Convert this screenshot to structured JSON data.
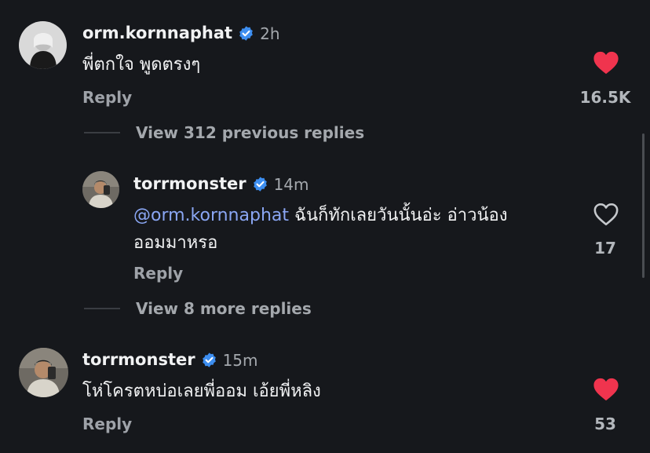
{
  "comments": [
    {
      "username": "orm.kornnaphat",
      "time": "2h",
      "text": "พี่ตกใจ พูดตรงๆ",
      "reply_label": "Reply",
      "likes": "16.5K",
      "liked": true
    },
    {
      "username": "torrmonster",
      "time": "14m",
      "mention": "@orm.kornnaphat",
      "text_line1": " ฉันก็ทักเลยวันนั้นอ่ะ  อ่าวน้อง",
      "text_line2": "ออมมาหรอ",
      "reply_label": "Reply",
      "likes": "17",
      "liked": false
    },
    {
      "username": "torrmonster",
      "time": "15m",
      "text": "โห่โครตหบ่อเลยพี่ออม เอ้ยพี่หลิง",
      "reply_label": "Reply",
      "likes": "53",
      "liked": true
    }
  ],
  "view_previous": "View 312 previous replies",
  "view_more": "View 8 more replies",
  "colors": {
    "background": "#16181c",
    "heart_liked": "#f0344e",
    "verified": "#3d8ef0",
    "mention": "#8aa6f3"
  }
}
